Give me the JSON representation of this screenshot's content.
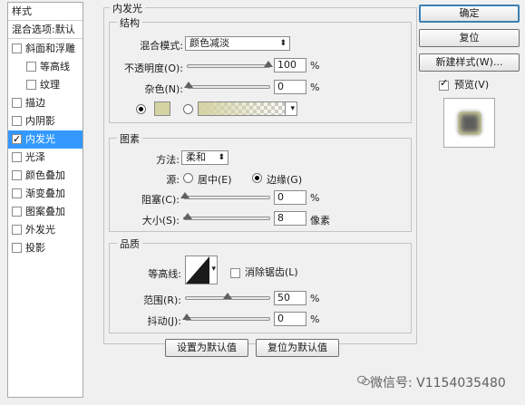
{
  "sidebar": {
    "header": "样式",
    "blend_options": "混合选项:默认",
    "items": [
      {
        "label": "斜面和浮雕",
        "checked": false,
        "indent": false
      },
      {
        "label": "等高线",
        "checked": false,
        "indent": true
      },
      {
        "label": "纹理",
        "checked": false,
        "indent": true
      },
      {
        "label": "描边",
        "checked": false,
        "indent": false
      },
      {
        "label": "内阴影",
        "checked": false,
        "indent": false
      },
      {
        "label": "内发光",
        "checked": true,
        "indent": false,
        "selected": true
      },
      {
        "label": "光泽",
        "checked": false,
        "indent": false
      },
      {
        "label": "颜色叠加",
        "checked": false,
        "indent": false
      },
      {
        "label": "渐变叠加",
        "checked": false,
        "indent": false
      },
      {
        "label": "图案叠加",
        "checked": false,
        "indent": false
      },
      {
        "label": "外发光",
        "checked": false,
        "indent": false
      },
      {
        "label": "投影",
        "checked": false,
        "indent": false
      }
    ]
  },
  "panel": {
    "title": "内发光",
    "structure": {
      "title": "结构",
      "blend_mode_label": "混合模式:",
      "blend_mode_value": "颜色减淡",
      "opacity_label": "不透明度(O):",
      "opacity_value": "100",
      "opacity_level": 1.0,
      "noise_label": "杂色(N):",
      "noise_value": "0",
      "noise_level": 0.0,
      "glow_color": "#d4d3a2",
      "unit_percent": "%"
    },
    "elements": {
      "title": "图素",
      "method_label": "方法:",
      "method_value": "柔和",
      "source_label": "源:",
      "source_center": "居中(E)",
      "source_edge": "边缘(G)",
      "source_selected": "edge",
      "choke_label": "阻塞(C):",
      "choke_value": "0",
      "choke_level": 0.0,
      "size_label": "大小(S):",
      "size_value": "8",
      "size_level": 0.03,
      "size_unit": "像素",
      "unit_percent": "%"
    },
    "quality": {
      "title": "品质",
      "contour_label": "等高线:",
      "anti_alias_label": "消除锯齿(L)",
      "range_label": "范围(R):",
      "range_value": "50",
      "range_level": 0.5,
      "jitter_label": "抖动(J):",
      "jitter_value": "0",
      "jitter_level": 0.0,
      "unit_percent": "%"
    },
    "make_default": "设置为默认值",
    "reset_default": "复位为默认值"
  },
  "actions": {
    "ok": "确定",
    "reset": "复位",
    "new_style": "新建样式(W)...",
    "preview_label": "预览(V)",
    "preview_checked": true
  },
  "watermark": "微信号: V1154035480"
}
